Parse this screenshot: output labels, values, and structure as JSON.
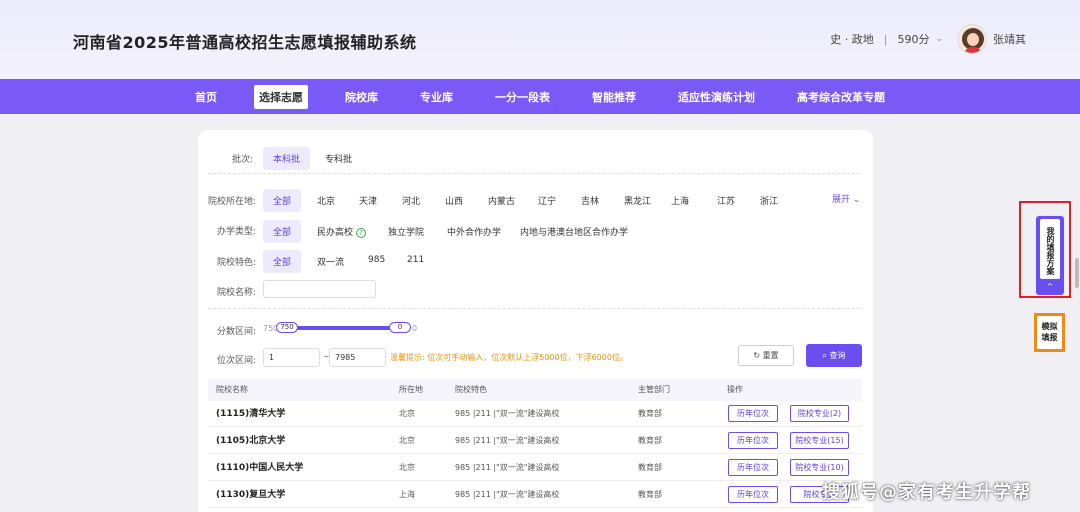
{
  "header": {
    "title": "河南省2025年普通高校招生志愿填报辅助系统",
    "subjects": "史 · 政地",
    "separator": "|",
    "score": "590分",
    "chevron": "⌄",
    "username": "张靖其"
  },
  "nav": [
    "首页",
    "选择志愿",
    "院校库",
    "专业库",
    "一分一段表",
    "智能推荐",
    "适应性演练计划",
    "高考综合改革专题"
  ],
  "filters": {
    "batch_label": "批次:",
    "batch_options": [
      "本科批",
      "专科批"
    ],
    "location_label": "院校所在地:",
    "location_options": [
      "全部",
      "北京",
      "天津",
      "河北",
      "山西",
      "内蒙古",
      "辽宁",
      "吉林",
      "黑龙江",
      "上海",
      "江苏",
      "浙江"
    ],
    "expand": "展开 ⌄",
    "type_label": "办学类型:",
    "type_options": [
      "全部",
      "民办高校",
      "独立学院",
      "中外合作办学",
      "内地与港澳台地区合作办学"
    ],
    "help_icon": "?",
    "feature_label": "院校特色:",
    "feature_options": [
      "全部",
      "双一流",
      "985",
      "211"
    ],
    "name_label": "院校名称:",
    "name_value": "",
    "score_label": "分数区间:",
    "score_min": "750",
    "score_thumb_left": "750",
    "score_thumb_right": "0",
    "score_max": "0",
    "rank_label": "位次区间:",
    "rank_from": "1",
    "rank_dash": "–",
    "rank_to": "7985",
    "hint": "温馨提示: 位次可手动输入，位次默认上浮5000位，下浮6000位。",
    "reset": "重置",
    "query": "查询"
  },
  "table": {
    "headers": [
      "院校名称",
      "所在地",
      "院校特色",
      "主管部门",
      "操作"
    ],
    "rows": [
      {
        "name": "(1115)清华大学",
        "location": "北京",
        "features": "985 |211 |\"双一流\"建设高校",
        "dept": "教育部",
        "btn1": "历年位次",
        "btn2": "院校专业(2)"
      },
      {
        "name": "(1105)北京大学",
        "location": "北京",
        "features": "985 |211 |\"双一流\"建设高校",
        "dept": "教育部",
        "btn1": "历年位次",
        "btn2": "院校专业(15)"
      },
      {
        "name": "(1110)中国人民大学",
        "location": "北京",
        "features": "985 |211 |\"双一流\"建设高校",
        "dept": "教育部",
        "btn1": "历年位次",
        "btn2": "院校专业(10)"
      },
      {
        "name": "(1130)复旦大学",
        "location": "上海",
        "features": "985 |211 |\"双一流\"建设高校",
        "dept": "教育部",
        "btn1": "历年位次",
        "btn2": "院校专业"
      }
    ]
  },
  "side": {
    "my_plan": "我的填报方案",
    "up": "^",
    "mock": "模拟填报"
  },
  "watermark": "搜狐号@家有考生升学帮",
  "colors": {
    "accent": "#7a5af6",
    "hint": "#e8920e",
    "highlight_red": "#e32020",
    "highlight_orange": "#f08a12"
  }
}
